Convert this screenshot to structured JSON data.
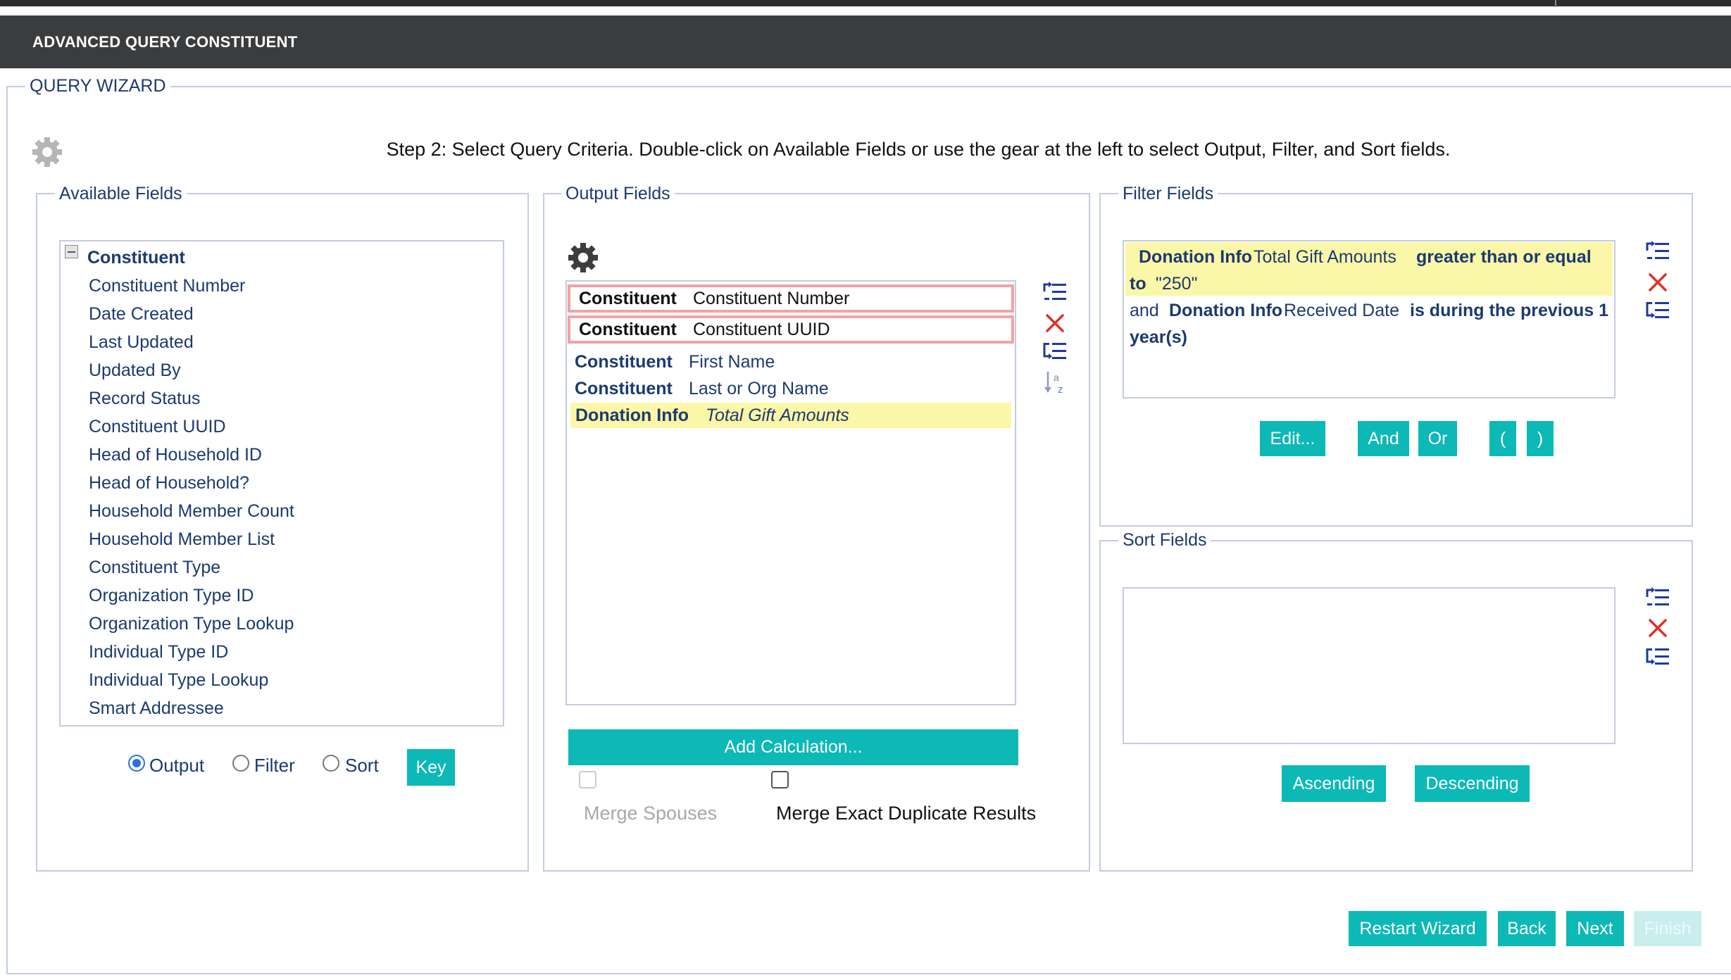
{
  "header": {
    "title": "ADVANCED QUERY CONSTITUENT"
  },
  "wizard": {
    "legend": "QUERY WIZARD",
    "step_text": "Step 2: Select Query Criteria. Double-click on Available Fields or use the gear at the left to select Output, Filter, and Sort fields."
  },
  "available": {
    "legend": "Available Fields",
    "root": "Constituent",
    "items": [
      "Constituent Number",
      "Date Created",
      "Last Updated",
      "Updated By",
      "Record Status",
      "Constituent UUID",
      "Head of Household ID",
      "Head of Household?",
      "Household Member Count",
      "Household Member List",
      "Constituent Type",
      "Organization Type ID",
      "Organization Type Lookup",
      "Individual Type ID",
      "Individual Type Lookup",
      "Smart Addressee"
    ],
    "radios": {
      "output": "Output",
      "filter": "Filter",
      "sort": "Sort",
      "selected": "Output"
    },
    "key_button": "Key"
  },
  "output": {
    "legend": "Output Fields",
    "rows": [
      {
        "table": "Constituent",
        "field": "Constituent Number"
      },
      {
        "table": "Constituent",
        "field": "Constituent UUID"
      },
      {
        "table": "Constituent",
        "field": "First Name"
      },
      {
        "table": "Constituent",
        "field": "Last or Org Name"
      },
      {
        "table": "Donation Info",
        "field": "Total Gift Amounts"
      }
    ],
    "add_calc_button": "Add Calculation...",
    "merge_spouses": "Merge Spouses",
    "merge_duplicates": "Merge Exact Duplicate Results"
  },
  "filter": {
    "legend": "Filter Fields",
    "line1": {
      "table": "Donation Info",
      "field": "Total Gift Amounts",
      "op": "greater than or equal",
      "to": "to",
      "value": "\"250\""
    },
    "line2": {
      "conj": "and",
      "table": "Donation Info",
      "field": "Received Date",
      "op": "is during the previous 1",
      "op2": "year(s)"
    },
    "buttons": {
      "edit": "Edit...",
      "and": "And",
      "or": "Or",
      "open": "(",
      "close": ")"
    }
  },
  "sort": {
    "legend": "Sort Fields",
    "ascending": "Ascending",
    "descending": "Descending"
  },
  "footer": {
    "restart": "Restart Wizard",
    "back": "Back",
    "next": "Next",
    "finish": "Finish"
  },
  "colors": {
    "accent": "#0cb9b6",
    "title_bg": "#3b3c3e",
    "text": "#1c3a70",
    "highlight": "#fbf7a8",
    "selected_border": "#f1a3a6"
  }
}
